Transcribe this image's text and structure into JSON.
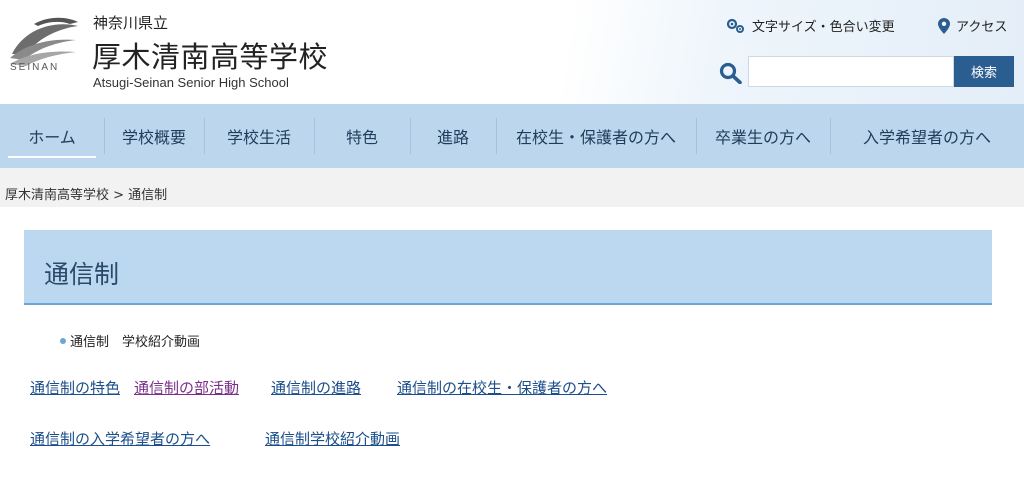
{
  "header": {
    "prefecture": "神奈川県立",
    "school_name": "厚木清南高等学校",
    "school_name_en": "Atsugi-Seinan Senior High School",
    "logo_text": "SEINAN",
    "text_size_label": "文字サイズ・色合い変更",
    "access_label": "アクセス",
    "search_placeholder": "",
    "search_button": "検索"
  },
  "nav": {
    "items": [
      {
        "label": "ホーム"
      },
      {
        "label": "学校概要"
      },
      {
        "label": "学校生活"
      },
      {
        "label": "特色"
      },
      {
        "label": "進路"
      },
      {
        "label": "在校生・保護者の方へ"
      },
      {
        "label": "卒業生の方へ"
      },
      {
        "label": "入学希望者の方へ"
      }
    ]
  },
  "breadcrumb": {
    "text": "厚木清南高等学校 > 通信制"
  },
  "main": {
    "title": "通信制",
    "bullet_item": "通信制　学校紹介動画",
    "links": [
      {
        "label": "通信制の特色"
      },
      {
        "label": "通信制の部活動"
      },
      {
        "label": "通信制の進路"
      },
      {
        "label": "通信制の在校生・保護者の方へ"
      },
      {
        "label": "通信制の入学希望者の方へ"
      },
      {
        "label": "通信制学校紹介動画"
      }
    ]
  },
  "colors": {
    "nav_bg": "#bcd6ed",
    "title_bg": "#bcd8f0",
    "search_button_bg": "#2b5e90",
    "link": "#1b4e8a",
    "visited_link": "#7a2f8a"
  }
}
